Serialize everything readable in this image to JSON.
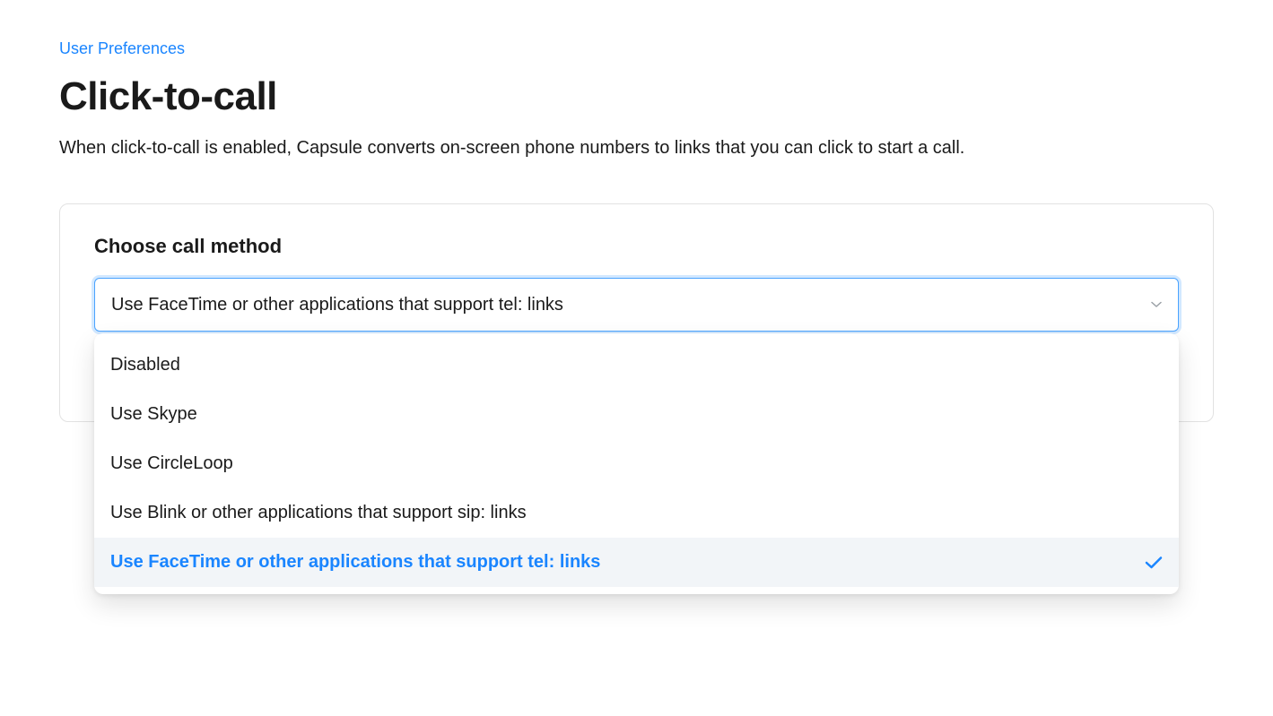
{
  "breadcrumb": {
    "label": "User Preferences"
  },
  "page": {
    "title": "Click-to-call",
    "description": "When click-to-call is enabled, Capsule converts on-screen phone numbers to links that you can click to start a call."
  },
  "card": {
    "field_label": "Choose call method",
    "select": {
      "selected_label": "Use FaceTime or other applications that support tel: links",
      "options": [
        {
          "label": "Disabled",
          "selected": false
        },
        {
          "label": "Use Skype",
          "selected": false
        },
        {
          "label": "Use CircleLoop",
          "selected": false
        },
        {
          "label": "Use Blink or other applications that support sip: links",
          "selected": false
        },
        {
          "label": "Use FaceTime or other applications that support tel: links",
          "selected": true
        }
      ]
    }
  },
  "colors": {
    "link": "#1a85ff",
    "border": "#e2e2e2",
    "focus_ring": "rgba(74,163,255,0.25)"
  }
}
